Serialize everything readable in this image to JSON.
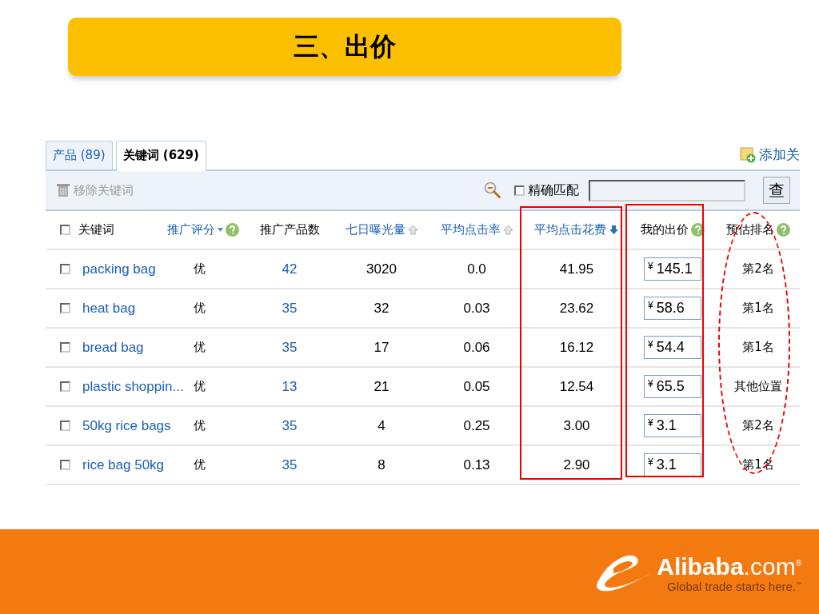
{
  "slide_title": "三、出价",
  "tabs": [
    {
      "label": "产品 (89)",
      "selected": false
    },
    {
      "label": "关键词 (629)",
      "selected": true
    }
  ],
  "add_link": "添加关",
  "toolbar": {
    "remove_button": {
      "label": "移除关键词",
      "disabled": true
    },
    "exact_match": {
      "label": "精确匹配",
      "checked": false
    },
    "search_button": "查"
  },
  "table": {
    "select_all": {
      "checked": false
    },
    "columns": [
      {
        "label": "关键词",
        "link": false,
        "sort_up": false,
        "sort_down": false,
        "help": false,
        "dropdown": false
      },
      {
        "label": "推广评分",
        "link": true,
        "sort_up": false,
        "sort_down": false,
        "help": true,
        "dropdown": true
      },
      {
        "label": "推广产品数",
        "link": false,
        "sort_up": false,
        "sort_down": false,
        "help": false,
        "dropdown": false
      },
      {
        "label": "七日曝光量",
        "link": true,
        "sort_up": true,
        "sort_down": false,
        "help": false,
        "dropdown": false
      },
      {
        "label": "平均点击率",
        "link": true,
        "sort_up": true,
        "sort_down": false,
        "help": false,
        "dropdown": false
      },
      {
        "label": "平均点击花费",
        "link": true,
        "sort_up": false,
        "sort_down": true,
        "help": false,
        "dropdown": false
      },
      {
        "label": "我的出价",
        "link": false,
        "sort_up": false,
        "sort_down": false,
        "help": true,
        "dropdown": false
      },
      {
        "label": "预估排名",
        "link": false,
        "sort_up": false,
        "sort_down": false,
        "help": true,
        "dropdown": false
      }
    ],
    "rows": [
      {
        "checked": false,
        "keyword": "packing bag",
        "score": "优",
        "products": "42",
        "impressions": "3020",
        "ctr": "0.0",
        "cpc": "41.95",
        "currency": "¥",
        "bid": "145.1",
        "rank": "第2名"
      },
      {
        "checked": false,
        "keyword": "heat bag",
        "score": "优",
        "products": "35",
        "impressions": "32",
        "ctr": "0.03",
        "cpc": "23.62",
        "currency": "¥",
        "bid": "58.6",
        "rank": "第1名"
      },
      {
        "checked": false,
        "keyword": "bread bag",
        "score": "优",
        "products": "35",
        "impressions": "17",
        "ctr": "0.06",
        "cpc": "16.12",
        "currency": "¥",
        "bid": "54.4",
        "rank": "第1名"
      },
      {
        "checked": false,
        "keyword": "plastic shoppin...",
        "score": "优",
        "products": "13",
        "impressions": "21",
        "ctr": "0.05",
        "cpc": "12.54",
        "currency": "¥",
        "bid": "65.5",
        "rank": "其他位置"
      },
      {
        "checked": false,
        "keyword": "50kg rice bags",
        "score": "优",
        "products": "35",
        "impressions": "4",
        "ctr": "0.25",
        "cpc": "3.00",
        "currency": "¥",
        "bid": "3.1",
        "rank": "第2名"
      },
      {
        "checked": false,
        "keyword": "rice bag 50kg",
        "score": "优",
        "products": "35",
        "impressions": "8",
        "ctr": "0.13",
        "cpc": "2.90",
        "currency": "¥",
        "bid": "3.1",
        "rank": "第1名"
      }
    ]
  },
  "footer": {
    "wordmark": "**Alibaba**.com$^{®}$",
    "tagline": "Global trade starts here.$^{™}$"
  }
}
